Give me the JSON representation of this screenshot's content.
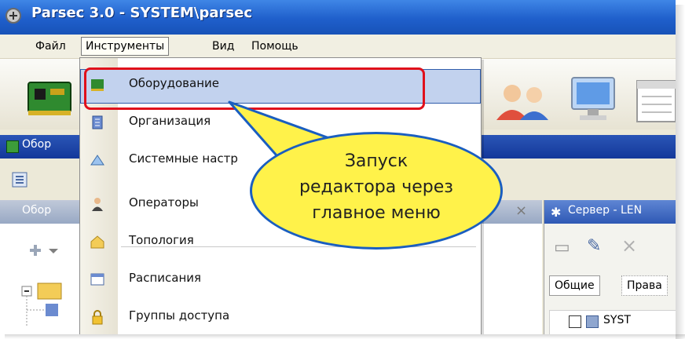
{
  "window": {
    "title": "Parsec 3.0 - SYSTEM\\parsec"
  },
  "menubar": {
    "items": [
      {
        "label": "Файл"
      },
      {
        "label": "Инструменты"
      },
      {
        "label": "Вид"
      },
      {
        "label": "Помощь"
      }
    ]
  },
  "panel": {
    "title": "Обор"
  },
  "left_pane": {
    "title": "Обор"
  },
  "right_pane": {
    "title": "Сервер - LEN",
    "tabs": [
      {
        "label": "Общие"
      },
      {
        "label": "Права"
      }
    ],
    "tree_item": "SYST"
  },
  "dropdown": {
    "items": [
      {
        "label": "Оборудование",
        "icon": "hardware-icon"
      },
      {
        "label": "Организация",
        "icon": "organization-icon"
      },
      {
        "label": "Системные настр",
        "icon": "system-settings-icon"
      },
      {
        "label": "Операторы",
        "icon": "operators-icon"
      },
      {
        "label": "Топология",
        "icon": "topology-icon"
      },
      {
        "label": "Расписания",
        "icon": "schedules-icon"
      },
      {
        "label": "Группы доступа",
        "icon": "access-groups-icon"
      }
    ]
  },
  "callout": {
    "line1": "Запуск",
    "line2": "редактора через",
    "line3": "главное меню"
  },
  "colors": {
    "highlight": "#c2d2ee",
    "annotation_red": "#e0101b",
    "callout_yellow": "#fff24a",
    "titlebar_blue": "#1f5fcb"
  }
}
